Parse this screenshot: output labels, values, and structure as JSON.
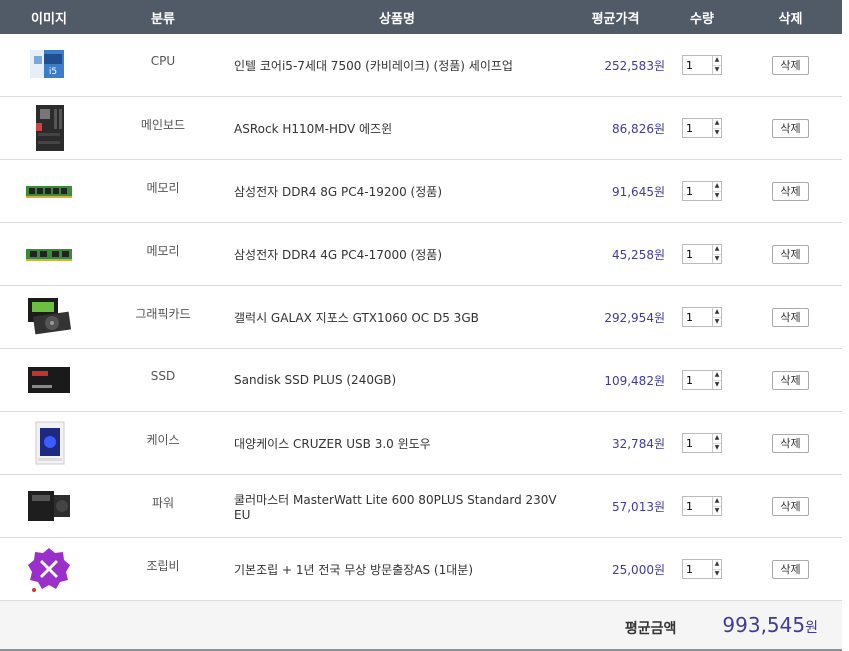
{
  "header": {
    "image": "이미지",
    "category": "분류",
    "product": "상품명",
    "avg_price": "평균가격",
    "qty": "수량",
    "delete": "삭제"
  },
  "rows": [
    {
      "icon": "cpu-box-image",
      "category": "CPU",
      "name": "인텔 코어i5-7세대 7500 (카비레이크) (정품) 세이프업",
      "price": "252,583원",
      "qty": "1",
      "del": "삭제"
    },
    {
      "icon": "motherboard-image",
      "category": "메인보드",
      "name": "ASRock H110M-HDV 에즈윈",
      "price": "86,826원",
      "qty": "1",
      "del": "삭제"
    },
    {
      "icon": "ram-stick-image",
      "category": "메모리",
      "name": "삼성전자 DDR4 8G PC4-19200 (정품)",
      "price": "91,645원",
      "qty": "1",
      "del": "삭제"
    },
    {
      "icon": "ram-stick-image",
      "category": "메모리",
      "name": "삼성전자 DDR4 4G PC4-17000 (정품)",
      "price": "45,258원",
      "qty": "1",
      "del": "삭제"
    },
    {
      "icon": "graphics-card-image",
      "category": "그래픽카드",
      "name": "갤럭시 GALAX 지포스 GTX1060 OC D5 3GB",
      "price": "292,954원",
      "qty": "1",
      "del": "삭제"
    },
    {
      "icon": "ssd-image",
      "category": "SSD",
      "name": "Sandisk SSD PLUS (240GB)",
      "price": "109,482원",
      "qty": "1",
      "del": "삭제"
    },
    {
      "icon": "pc-case-image",
      "category": "케이스",
      "name": "대양케이스 CRUZER USB 3.0 윈도우",
      "price": "32,784원",
      "qty": "1",
      "del": "삭제"
    },
    {
      "icon": "power-supply-image",
      "category": "파워",
      "name": "쿨러마스터 MasterWatt Lite 600 80PLUS Standard 230V EU",
      "price": "57,013원",
      "qty": "1",
      "del": "삭제"
    },
    {
      "icon": "assembly-tools-badge-image",
      "category": "조립비",
      "name": "기본조립 + 1년 전국 무상 방문출장AS (1대분)",
      "price": "25,000원",
      "qty": "1",
      "del": "삭제"
    }
  ],
  "footer": {
    "total_label": "평균금액",
    "total_value": "993,545",
    "total_unit": "원"
  },
  "colors": {
    "header_bg": "#515a67",
    "price": "#3f3aa0"
  }
}
